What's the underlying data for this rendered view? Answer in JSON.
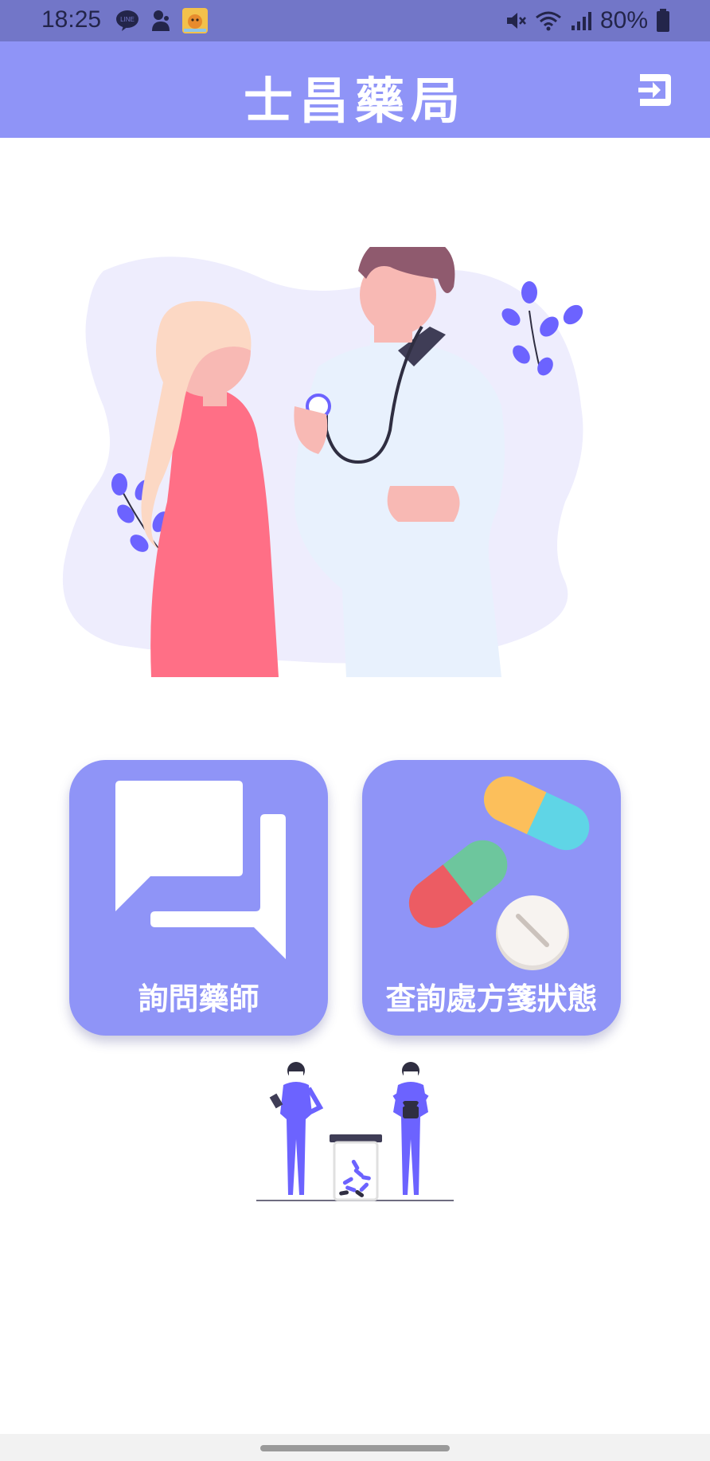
{
  "status_bar": {
    "time": "18:25",
    "battery": "80%",
    "left_icons": [
      "line-icon",
      "notification-icon",
      "app-icon"
    ],
    "right_icons": [
      "mute-icon",
      "wifi-icon",
      "signal-icon",
      "battery-icon"
    ]
  },
  "header": {
    "title": "士昌藥局",
    "background": "#8f94f7",
    "logout_icon": "logout-icon"
  },
  "hero": {
    "illustration": "doctor-patient-illustration"
  },
  "actions": [
    {
      "label": "詢問藥師",
      "icon": "chat-bubbles-icon"
    },
    {
      "label": "查詢處方箋狀態",
      "icon": "pills-icon"
    }
  ],
  "footer": {
    "illustration": "pharmacists-illustration"
  },
  "colors": {
    "status_bar": "#7276c8",
    "accent": "#8f94f7",
    "card_text": "#ffffff"
  }
}
